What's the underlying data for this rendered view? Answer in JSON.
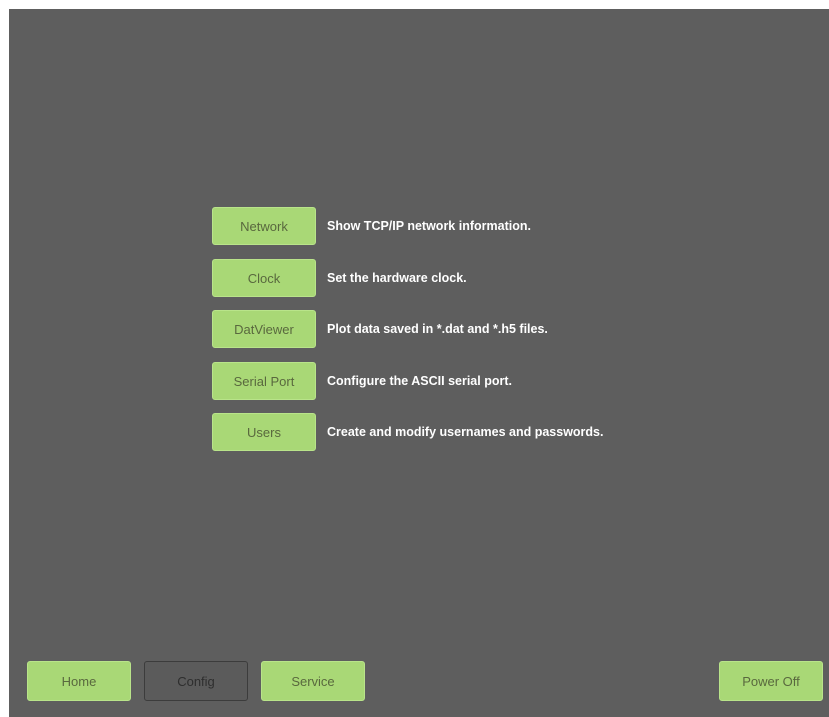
{
  "menu": [
    {
      "button_label": "Network",
      "description": "Show TCP/IP network information."
    },
    {
      "button_label": "Clock",
      "description": "Set the hardware clock."
    },
    {
      "button_label": "DatViewer",
      "description": "Plot data saved in *.dat and *.h5 files."
    },
    {
      "button_label": "Serial Port",
      "description": "Configure the ASCII serial port."
    },
    {
      "button_label": "Users",
      "description": "Create and modify usernames and passwords."
    }
  ],
  "bottom_nav": {
    "home_label": "Home",
    "config_label": "Config",
    "service_label": "Service",
    "power_off_label": "Power Off",
    "active_tab": "Config"
  },
  "colors": {
    "background": "#5e5e5e",
    "button_green": "#a9d876",
    "button_text": "#59683e",
    "description_text": "#ffffff"
  }
}
